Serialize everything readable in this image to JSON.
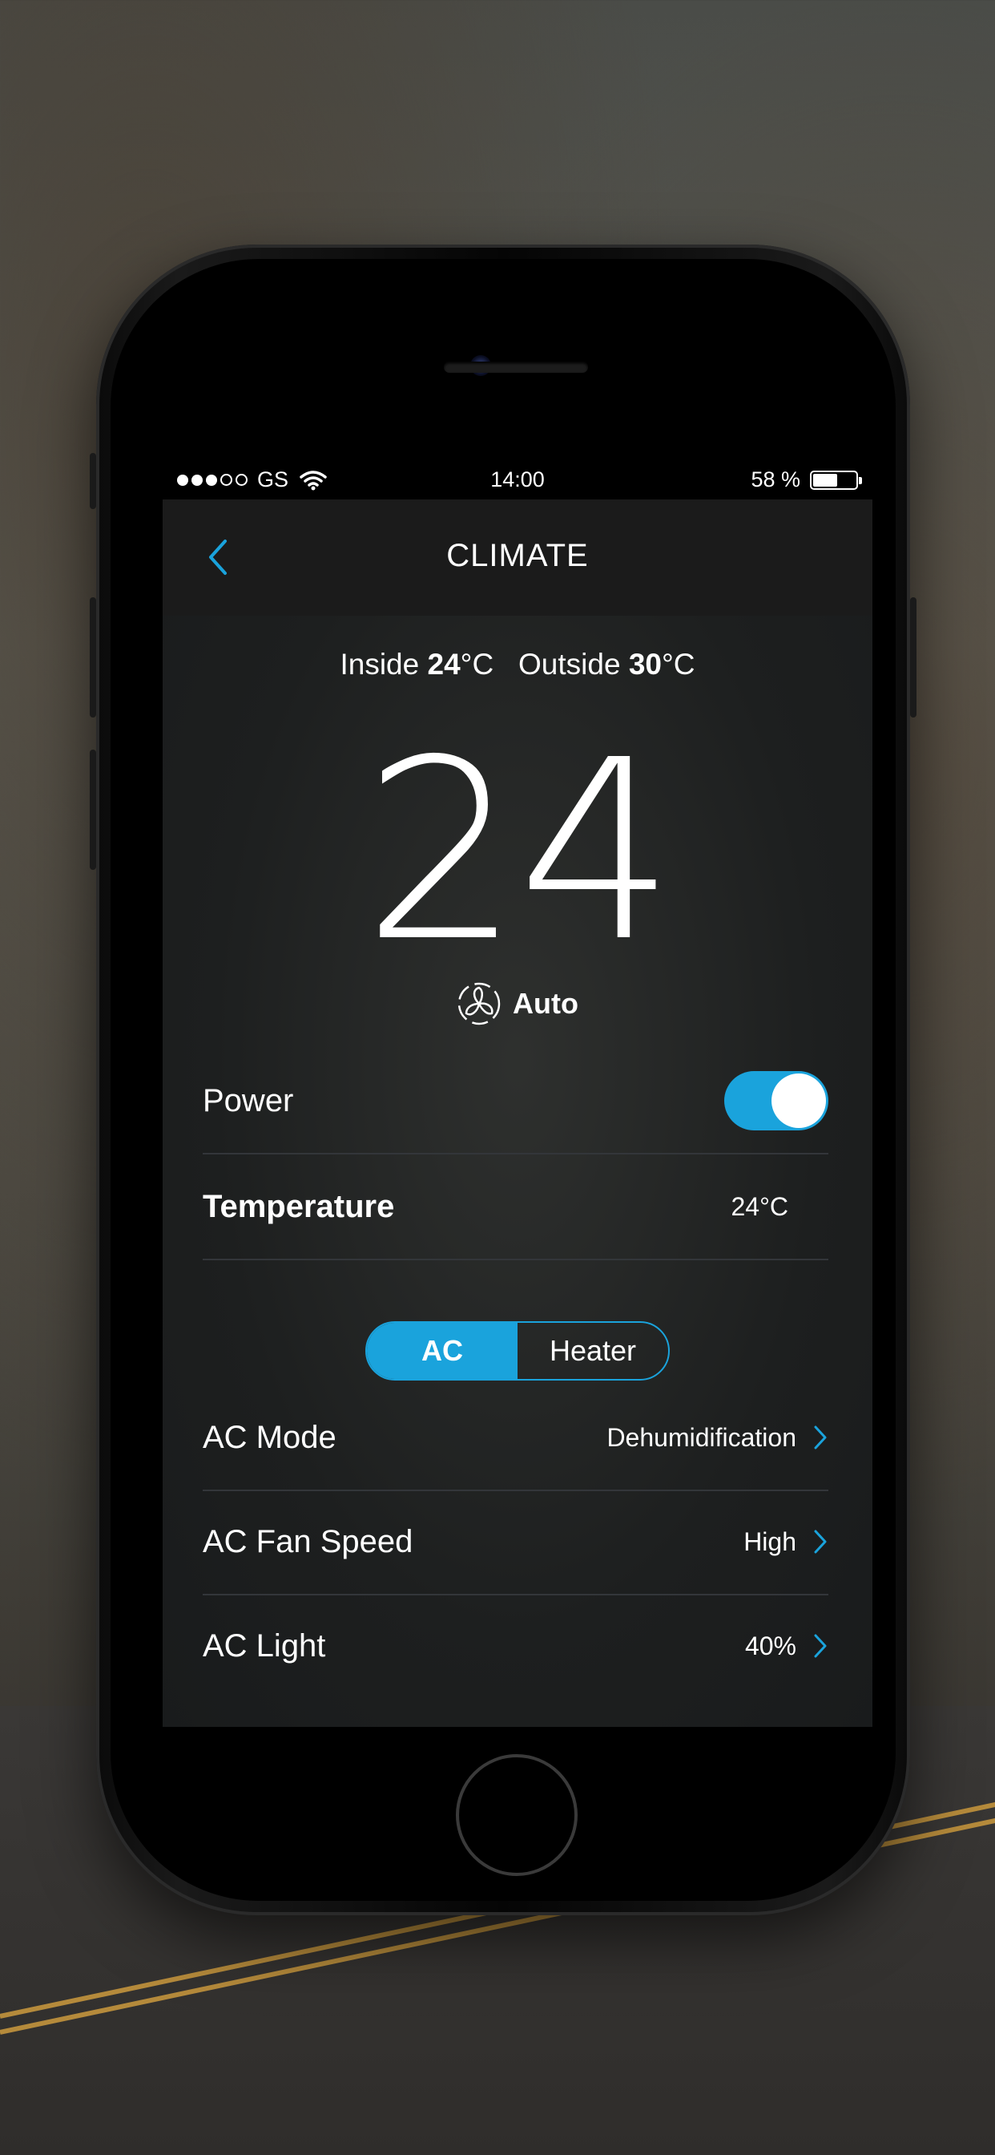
{
  "status_bar": {
    "carrier": "GS",
    "time": "14:00",
    "battery_text": "58 %",
    "battery_level": 0.58
  },
  "nav": {
    "title": "CLIMATE",
    "back_icon": "chevron-left-icon"
  },
  "temps": {
    "inside_label": "Inside",
    "inside_value": "24",
    "outside_label": "Outside",
    "outside_value": "30",
    "unit": "°C"
  },
  "set_temp": "24",
  "fan_mode": "Auto",
  "power": {
    "label": "Power",
    "on": true
  },
  "temperature": {
    "label": "Temperature",
    "value": "24°C"
  },
  "segment": {
    "ac": "AC",
    "heater": "Heater",
    "active": "AC"
  },
  "ac_rows": [
    {
      "label": "AC Mode",
      "value": "Dehumidification"
    },
    {
      "label": "AC Fan Speed",
      "value": "High"
    },
    {
      "label": "AC Light",
      "value": "40%"
    }
  ],
  "colors": {
    "accent": "#1aa3dc"
  }
}
